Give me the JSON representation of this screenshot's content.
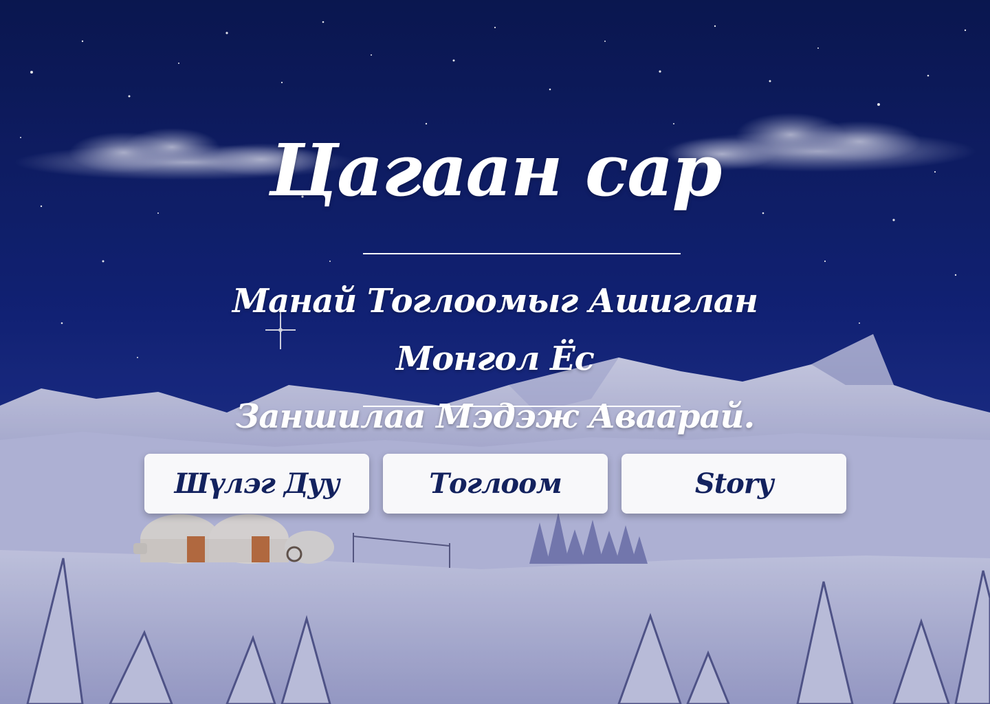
{
  "hero": {
    "title": "Цагаан сар",
    "subtitle_line1": "Манай Тоглоомыг Ашиглан Монгол Ёс",
    "subtitle_line2": "Заншилаа Мэдэж Аваарай."
  },
  "buttons": [
    {
      "label": "Шүлэг Дуу"
    },
    {
      "label": "Тоглоом"
    },
    {
      "label": "Story"
    }
  ],
  "colors": {
    "sky": "#0c1a52",
    "snow": "#c9cbe6",
    "button_bg": "#f8f8fa",
    "button_text": "#13225e",
    "text": "#ffffff"
  }
}
